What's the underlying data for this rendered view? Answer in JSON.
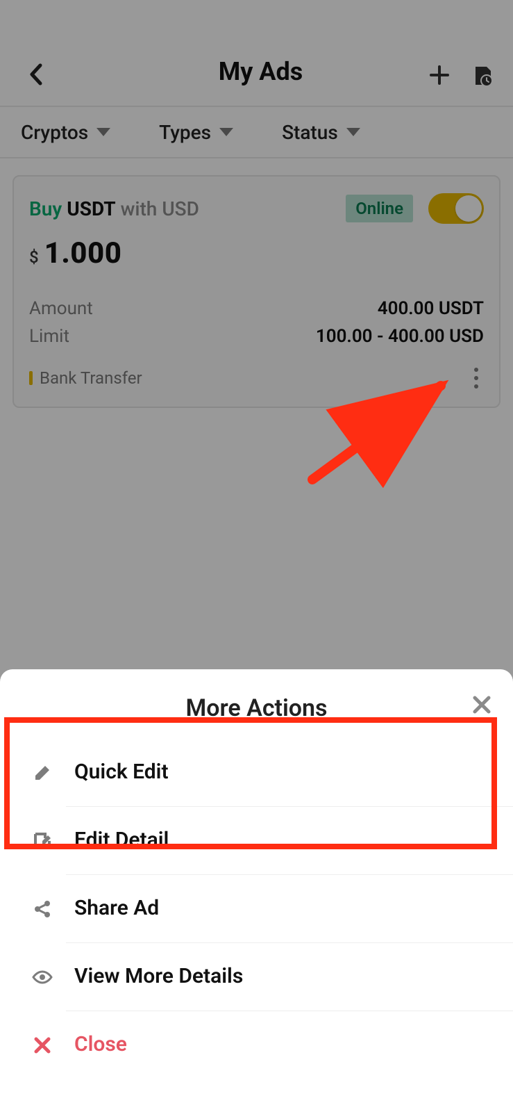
{
  "header": {
    "title": "My Ads"
  },
  "filters": {
    "cryptos": "Cryptos",
    "types": "Types",
    "status": "Status"
  },
  "ad": {
    "side": "Buy",
    "crypto": "USDT",
    "with_word": "with",
    "fiat": "USD",
    "status": "Online",
    "currency_symbol": "$",
    "price": "1.000",
    "amount_label": "Amount",
    "amount_value": "400.00 USDT",
    "limit_label": "Limit",
    "limit_value": "100.00 - 400.00 USD",
    "payment_method": "Bank Transfer"
  },
  "sheet": {
    "title": "More Actions",
    "items": {
      "quick_edit": "Quick Edit",
      "edit_detail": "Edit Detail",
      "share_ad": "Share Ad",
      "view_more": "View More Details",
      "close": "Close"
    }
  }
}
